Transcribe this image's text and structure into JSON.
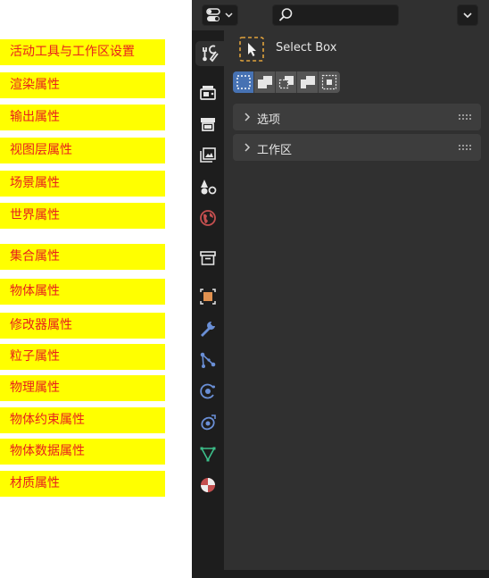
{
  "labels": [
    "活动工具与工作区设置",
    "渲染属性",
    "输出属性",
    "视图层属性",
    "场景属性",
    "世界属性",
    "集合属性",
    "物体属性",
    "修改器属性",
    "粒子属性",
    "物理属性",
    "物体约束属性",
    "物体数据属性",
    "材质属性"
  ],
  "header": {
    "search_placeholder": ""
  },
  "tool": {
    "name": "Select Box"
  },
  "panels": {
    "options": "选项",
    "workspace": "工作区"
  },
  "colors": {
    "accent": "#4772b3",
    "label_bg": "#ffff00",
    "label_text": "#e8201c",
    "tool_dash": "#e0a23c"
  },
  "tabs": [
    "tool-icon",
    "render-icon",
    "output-icon",
    "view-layer-icon",
    "scene-icon",
    "world-icon",
    "collection-icon",
    "object-icon",
    "modifier-icon",
    "particles-icon",
    "physics-icon",
    "constraints-icon",
    "object-data-icon",
    "material-icon"
  ]
}
